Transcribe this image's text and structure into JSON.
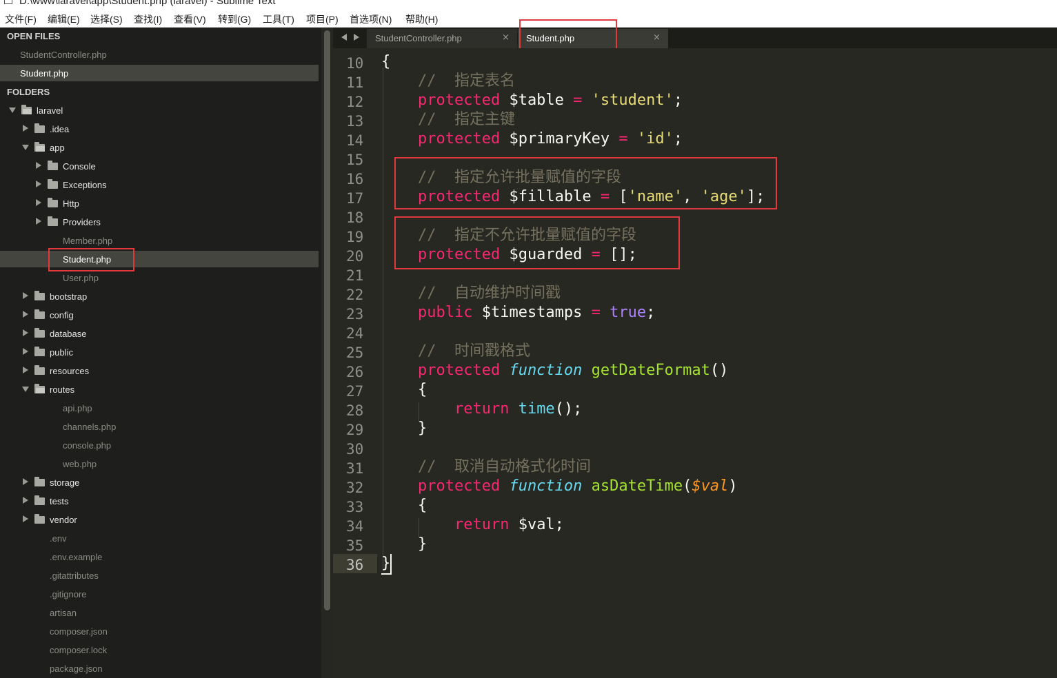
{
  "window": {
    "title": "D:\\www\\laravel\\app\\Student.php (laravel) - Sublime Text"
  },
  "menu": [
    "文件(F)",
    "编辑(E)",
    "选择(S)",
    "查找(I)",
    "查看(V)",
    "转到(G)",
    "工具(T)",
    "项目(P)",
    "首选项(N)",
    "帮助(H)"
  ],
  "sidebar": {
    "open_files_header": "OPEN FILES",
    "open_files": [
      "StudentController.php",
      "Student.php"
    ],
    "folders_header": "FOLDERS",
    "tree": [
      {
        "label": "laravel",
        "kind": "folder-open"
      },
      {
        "label": ".idea",
        "kind": "folder"
      },
      {
        "label": "app",
        "kind": "folder-open"
      },
      {
        "label": "Console",
        "kind": "folder"
      },
      {
        "label": "Exceptions",
        "kind": "folder"
      },
      {
        "label": "Http",
        "kind": "folder"
      },
      {
        "label": "Providers",
        "kind": "folder"
      },
      {
        "label": "Member.php",
        "kind": "file"
      },
      {
        "label": "Student.php",
        "kind": "file"
      },
      {
        "label": "User.php",
        "kind": "file"
      },
      {
        "label": "bootstrap",
        "kind": "folder"
      },
      {
        "label": "config",
        "kind": "folder"
      },
      {
        "label": "database",
        "kind": "folder"
      },
      {
        "label": "public",
        "kind": "folder"
      },
      {
        "label": "resources",
        "kind": "folder"
      },
      {
        "label": "routes",
        "kind": "folder-open"
      },
      {
        "label": "api.php",
        "kind": "file"
      },
      {
        "label": "channels.php",
        "kind": "file"
      },
      {
        "label": "console.php",
        "kind": "file"
      },
      {
        "label": "web.php",
        "kind": "file"
      },
      {
        "label": "storage",
        "kind": "folder"
      },
      {
        "label": "tests",
        "kind": "folder"
      },
      {
        "label": "vendor",
        "kind": "folder"
      },
      {
        "label": ".env",
        "kind": "file"
      },
      {
        "label": ".env.example",
        "kind": "file"
      },
      {
        "label": ".gitattributes",
        "kind": "file"
      },
      {
        "label": ".gitignore",
        "kind": "file"
      },
      {
        "label": "artisan",
        "kind": "file"
      },
      {
        "label": "composer.json",
        "kind": "file"
      },
      {
        "label": "composer.lock",
        "kind": "file"
      },
      {
        "label": "package.json",
        "kind": "file"
      }
    ]
  },
  "tabs": [
    {
      "label": "StudentController.php",
      "close": "×",
      "active": false
    },
    {
      "label": "Student.php",
      "close": "×",
      "active": true
    }
  ],
  "editor": {
    "current_line": "36",
    "line_numbers": [
      "10",
      "11",
      "12",
      "13",
      "14",
      "15",
      "16",
      "17",
      "18",
      "19",
      "20",
      "21",
      "22",
      "23",
      "24",
      "25",
      "26",
      "27",
      "28",
      "29",
      "30",
      "31",
      "32",
      "33",
      "34",
      "35",
      "36"
    ],
    "code": {
      "l10": "{",
      "l11_comment": "//  指定表名",
      "l12_kw": "protected",
      "l12_var": " $table ",
      "l12_op": "=",
      "l12_str": " 'student'",
      "l12_end": ";",
      "l13_comment": "//  指定主键",
      "l14_kw": "protected",
      "l14_var": " $primaryKey ",
      "l14_op": "=",
      "l14_str": " 'id'",
      "l14_end": ";",
      "l16_comment": "//  指定允许批量赋值的字段",
      "l17_kw": "protected",
      "l17_var": " $fillable ",
      "l17_op": "=",
      "l17_b1": " [",
      "l17_s1": "'name'",
      "l17_c": ", ",
      "l17_s2": "'age'",
      "l17_b2": "];",
      "l19_comment": "//  指定不允许批量赋值的字段",
      "l20_kw": "protected",
      "l20_var": " $guarded ",
      "l20_op": "=",
      "l20_end": " [];",
      "l22_comment": "//  自动维护时间戳",
      "l23_kw": "public",
      "l23_var": " $timestamps ",
      "l23_op": "=",
      "l23_val": " true",
      "l23_end": ";",
      "l25_comment": "//  时间戳格式",
      "l26_kw": "protected",
      "l26_fk": " function",
      "l26_name": " getDateFormat",
      "l26_end": "()",
      "l27": "{",
      "l28_kw": "return",
      "l28_fn": " time",
      "l28_end": "();",
      "l29": "}",
      "l31_comment": "//  取消自动格式化时间",
      "l32_kw": "protected",
      "l32_fk": " function",
      "l32_name": " asDateTime",
      "l32_p1": "(",
      "l32_param": "$val",
      "l32_p2": ")",
      "l33": "{",
      "l34_kw": "return",
      "l34_end": " $val;",
      "l35": "}",
      "l36": "}"
    }
  },
  "colors": {
    "background": "#272822",
    "keyword": "#f92672",
    "string": "#e6db74",
    "function": "#a6e22e",
    "storage": "#66d9ef",
    "constant": "#ae81ff",
    "comment": "#75715e",
    "annotation_box": "#e0393e"
  }
}
